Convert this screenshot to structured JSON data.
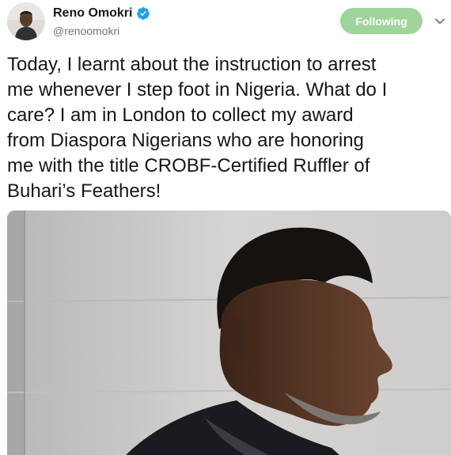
{
  "author": {
    "display_name": "Reno Omokri",
    "handle": "@renoomokri",
    "verified_icon": "verified-badge-icon",
    "avatar_image": "profile photo of man in dark jacket"
  },
  "follow_button": {
    "label": "Following",
    "color": "#9fd49a"
  },
  "menu": {
    "icon": "chevron-down-icon"
  },
  "tweet": {
    "text": "Today, I learnt about the instruction to arrest\nme whenever I step foot in Nigeria. What do I\ncare? I am in London to collect my award\nfrom Diaspora Nigerians who are honoring\nme with the title CROBF-Certified Ruffler of\nBuhari’s Feathers!"
  },
  "colors": {
    "verified_blue": "#1da1f2",
    "text": "#14171a",
    "secondary_text": "#657786"
  }
}
